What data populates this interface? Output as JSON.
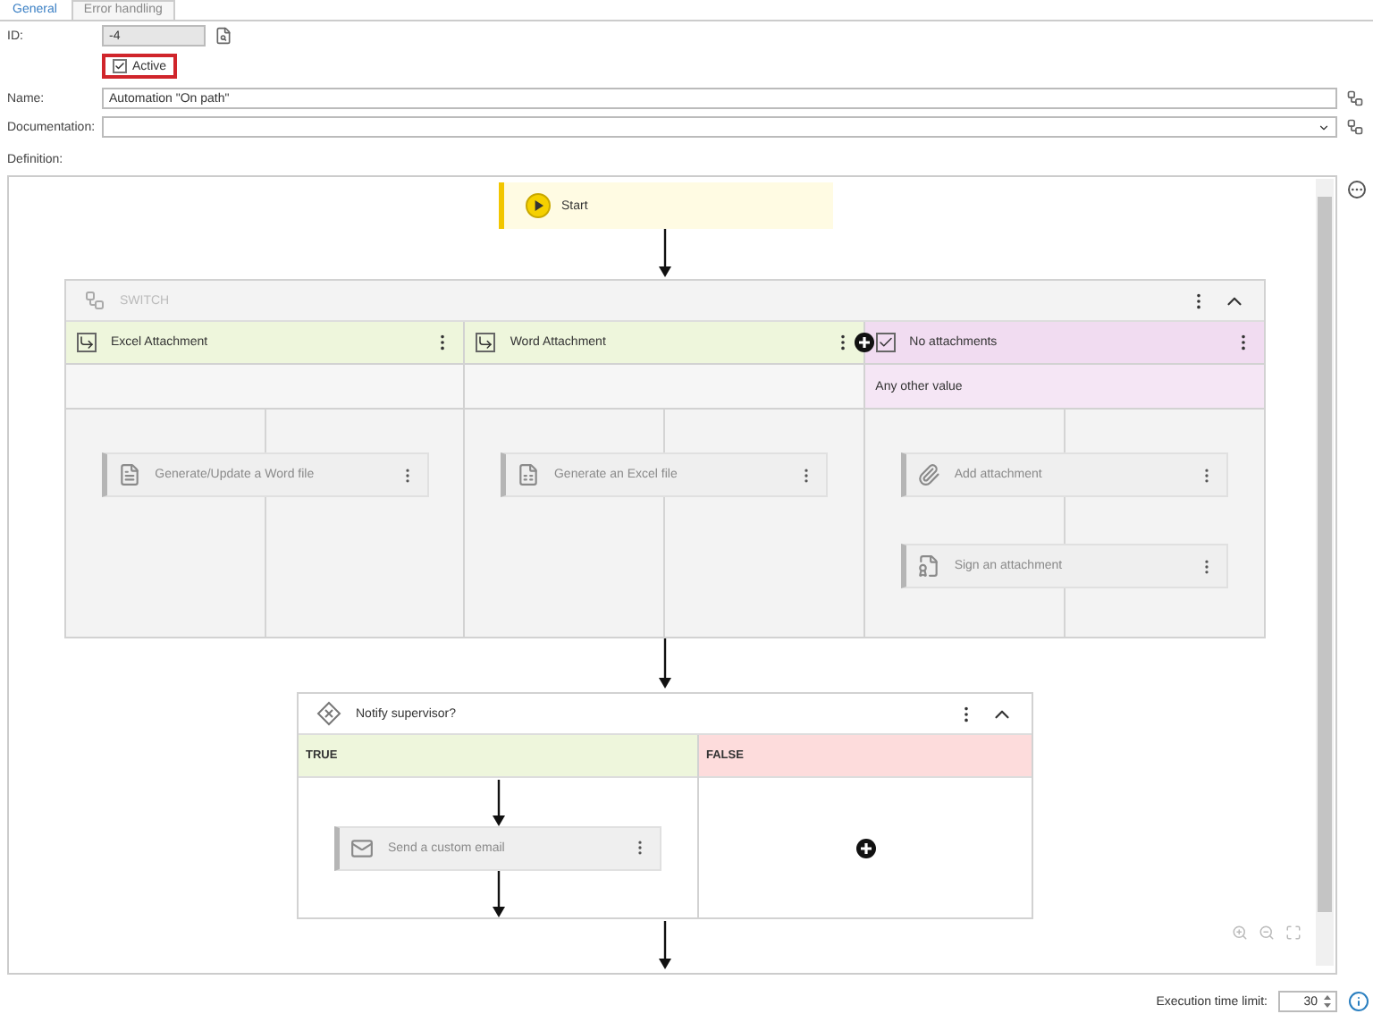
{
  "tabs": [
    {
      "label": "General",
      "selected": true
    },
    {
      "label": "Error handling",
      "selected": false
    }
  ],
  "form": {
    "id_label": "ID:",
    "id_value": "-4",
    "active": {
      "label": "Active",
      "checked": true,
      "highlighted": true
    },
    "name_label": "Name:",
    "name_value": "Automation \"On path\"",
    "documentation_label": "Documentation:",
    "definition_label": "Definition:"
  },
  "start": {
    "label": "Start"
  },
  "switch": {
    "title": "SWITCH",
    "disabled": true,
    "branches": [
      {
        "label": "Excel Attachment",
        "kind": "case",
        "actions": [
          {
            "label": "Generate/Update a Word file",
            "kind": "word",
            "disabled": true
          }
        ]
      },
      {
        "label": "Word Attachment",
        "kind": "case",
        "actions": [
          {
            "label": "Generate an Excel file",
            "kind": "excel",
            "disabled": true
          }
        ]
      },
      {
        "label": "No attachments",
        "kind": "default",
        "condition": "Any other value",
        "actions": [
          {
            "label": "Add attachment",
            "kind": "attach",
            "disabled": true
          },
          {
            "label": "Sign an attachment",
            "kind": "sign",
            "disabled": true
          }
        ]
      }
    ]
  },
  "decision": {
    "title": "Notify supervisor?",
    "branches": [
      {
        "label": "TRUE",
        "kind": "true",
        "actions": [
          {
            "label": "Send a custom email",
            "kind": "email",
            "disabled": true
          }
        ]
      },
      {
        "label": "FALSE",
        "kind": "false"
      }
    ]
  },
  "footer": {
    "label": "Execution time limit:",
    "value": "30"
  }
}
